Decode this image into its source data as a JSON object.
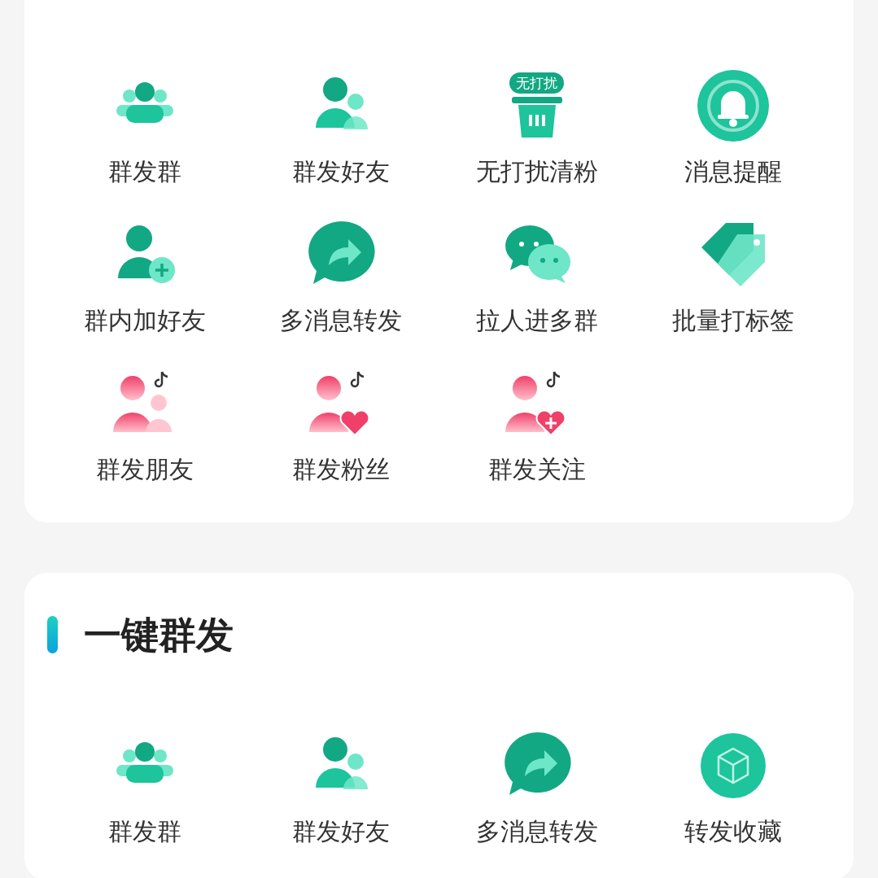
{
  "sections": [
    {
      "items": [
        {
          "kind": "group",
          "label": "群发群"
        },
        {
          "kind": "friend",
          "label": "群发好友"
        },
        {
          "kind": "nodisturb",
          "label": "无打扰清粉",
          "badge": "无打扰"
        },
        {
          "kind": "bell",
          "label": "消息提醒"
        },
        {
          "kind": "addfriend",
          "label": "群内加好友"
        },
        {
          "kind": "forward",
          "label": "多消息转发"
        },
        {
          "kind": "chat",
          "label": "拉人进多群"
        },
        {
          "kind": "tag",
          "label": "批量打标签"
        },
        {
          "kind": "tiktokfriend",
          "label": "群发朋友"
        },
        {
          "kind": "tiktokfan",
          "label": "群发粉丝"
        },
        {
          "kind": "tiktokfollow",
          "label": "群发关注"
        }
      ]
    },
    {
      "title": "一键群发",
      "items": [
        {
          "kind": "group",
          "label": "群发群"
        },
        {
          "kind": "friend",
          "label": "群发好友"
        },
        {
          "kind": "forward",
          "label": "多消息转发"
        },
        {
          "kind": "box",
          "label": "转发收藏"
        }
      ]
    }
  ]
}
